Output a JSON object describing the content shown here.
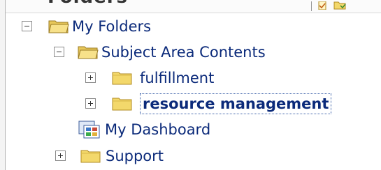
{
  "header": {
    "title": "Folders"
  },
  "tree": {
    "root": {
      "label": "My Folders",
      "expanded": true
    },
    "subject_area": {
      "label": "Subject Area Contents",
      "expanded": true
    },
    "fulfillment": {
      "label": "fulfillment",
      "expanded": false
    },
    "resource_management": {
      "label": "resource management",
      "expanded": false,
      "selected": true
    },
    "my_dashboard": {
      "label": "My Dashboard"
    },
    "support": {
      "label": "Support",
      "expanded": false
    }
  },
  "icons": {
    "header_left": "page-icon",
    "header_right": "folder-icon",
    "folder": "folder-icon",
    "folder_open": "folder-open-icon",
    "dashboard": "dashboard-icon"
  },
  "colors": {
    "label": "#0b2a7a",
    "folder_fill": "#f3d86b",
    "folder_edge": "#b08b22",
    "selection_outline": "#3a5fa8"
  }
}
